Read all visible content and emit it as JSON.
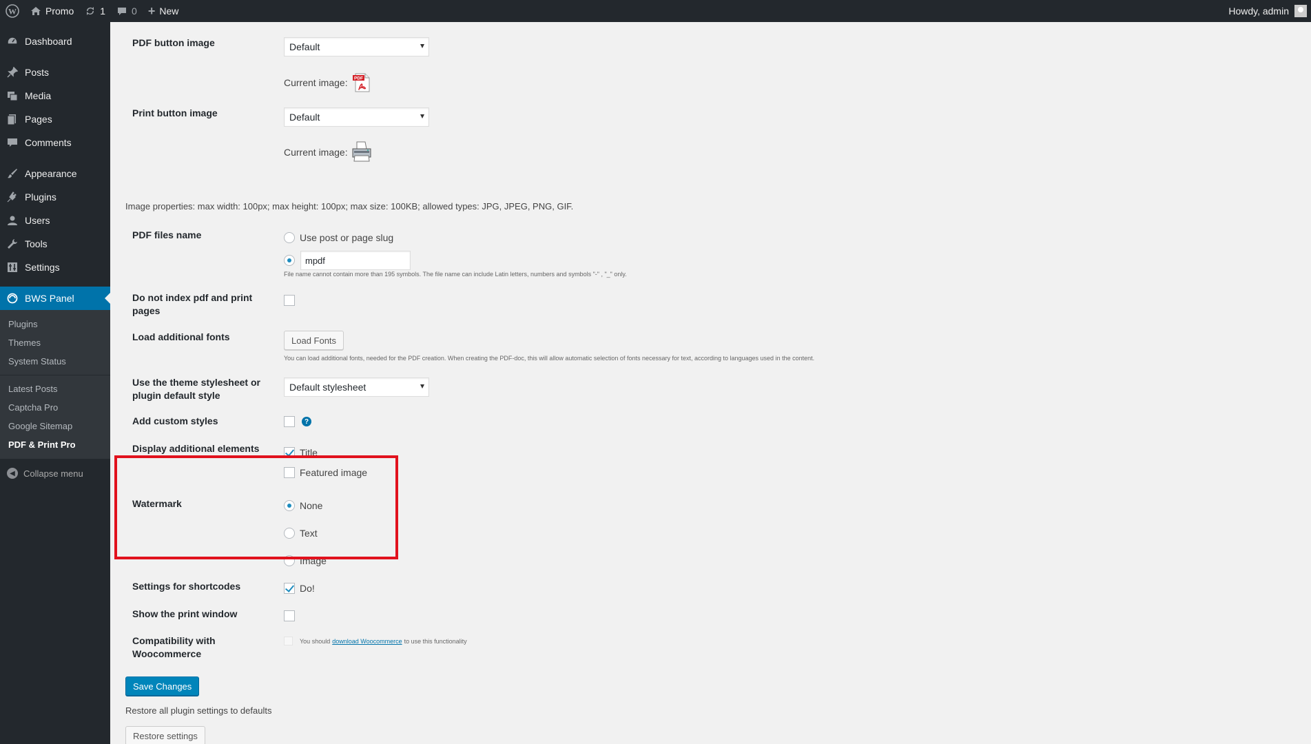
{
  "adminbar": {
    "site_name": "Promo",
    "updates_count": "1",
    "comments_count": "0",
    "new_label": "New",
    "howdy": "Howdy, admin"
  },
  "sidebar": {
    "items": [
      {
        "label": "Dashboard",
        "icon": "dashboard-icon"
      },
      {
        "label": "Posts",
        "icon": "pin-icon"
      },
      {
        "label": "Media",
        "icon": "media-icon"
      },
      {
        "label": "Pages",
        "icon": "pages-icon"
      },
      {
        "label": "Comments",
        "icon": "comment-icon"
      },
      {
        "label": "Appearance",
        "icon": "brush-icon"
      },
      {
        "label": "Plugins",
        "icon": "plug-icon"
      },
      {
        "label": "Users",
        "icon": "user-icon"
      },
      {
        "label": "Tools",
        "icon": "wrench-icon"
      },
      {
        "label": "Settings",
        "icon": "settings-icon"
      },
      {
        "label": "BWS Panel",
        "icon": "bws-icon"
      }
    ],
    "submenu_group1": [
      "Plugins",
      "Themes",
      "System Status"
    ],
    "submenu_group2": [
      "Latest Posts",
      "Captcha Pro",
      "Google Sitemap",
      "PDF & Print Pro"
    ],
    "collapse_label": "Collapse menu"
  },
  "settings": {
    "pdf_button_image": {
      "label": "PDF button image",
      "value": "Default",
      "current_label": "Current image:"
    },
    "print_button_image": {
      "label": "Print button image",
      "value": "Default",
      "current_label": "Current image:"
    },
    "image_properties": "Image properties: max width: 100px; max height: 100px; max size: 100KB; allowed types: JPG, JPEG, PNG, GIF.",
    "pdf_files_name": {
      "label": "PDF files name",
      "option_slug": "Use post or page slug",
      "custom_value": "mpdf",
      "note": "File name cannot contain more than 195 symbols. The file name can include Latin letters, numbers and symbols \"-\" , \"_\" only."
    },
    "do_not_index": {
      "label": "Do not index pdf and print pages"
    },
    "load_fonts": {
      "label": "Load additional fonts",
      "button": "Load Fonts",
      "note": "You can load additional fonts, needed for the PDF creation. When creating the PDF-doc, this will allow automatic selection of fonts necessary for text, according to languages used in the content."
    },
    "stylesheet": {
      "label": "Use the theme stylesheet or plugin default style",
      "value": "Default stylesheet"
    },
    "custom_styles": {
      "label": "Add custom styles",
      "help": "?"
    },
    "display_elements": {
      "label": "Display additional elements",
      "opt_title": "Title",
      "opt_featured": "Featured image"
    },
    "watermark": {
      "label": "Watermark",
      "opt_none": "None",
      "opt_text": "Text",
      "opt_image": "Image"
    },
    "shortcodes": {
      "label": "Settings for shortcodes",
      "opt": "Do!"
    },
    "print_window": {
      "label": "Show the print window"
    },
    "woocommerce": {
      "label": "Compatibility with Woocommerce",
      "note_prefix": "You should",
      "note_link": "download Woocommerce",
      "note_suffix": "to use this functionality"
    },
    "save_button": "Save Changes",
    "restore_text": "Restore all plugin settings to defaults",
    "restore_button": "Restore settings"
  },
  "colors": {
    "accent": "#0073aa",
    "highlight_border": "#e1121d"
  }
}
